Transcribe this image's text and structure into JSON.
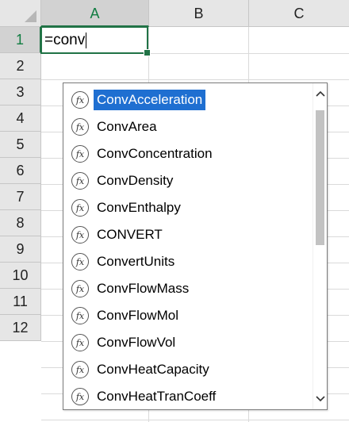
{
  "columns": [
    {
      "label": "A",
      "selected": true
    },
    {
      "label": "B",
      "selected": false
    },
    {
      "label": "C",
      "selected": false
    }
  ],
  "rows": [
    "1",
    "2",
    "3",
    "4",
    "5",
    "6",
    "7",
    "8",
    "9",
    "10",
    "11",
    "12"
  ],
  "active_cell": {
    "reference": "A1",
    "formula": "=conv"
  },
  "autocomplete": {
    "highlighted_index": 0,
    "items": [
      {
        "label": "ConvAcceleration",
        "icon": "function-icon"
      },
      {
        "label": "ConvArea",
        "icon": "function-icon"
      },
      {
        "label": "ConvConcentration",
        "icon": "function-icon"
      },
      {
        "label": "ConvDensity",
        "icon": "function-icon"
      },
      {
        "label": "ConvEnthalpy",
        "icon": "function-icon"
      },
      {
        "label": "CONVERT",
        "icon": "function-icon"
      },
      {
        "label": "ConvertUnits",
        "icon": "function-icon"
      },
      {
        "label": "ConvFlowMass",
        "icon": "function-icon"
      },
      {
        "label": "ConvFlowMol",
        "icon": "function-icon"
      },
      {
        "label": "ConvFlowVol",
        "icon": "function-icon"
      },
      {
        "label": "ConvHeatCapacity",
        "icon": "function-icon"
      },
      {
        "label": "ConvHeatTranCoeff",
        "icon": "function-icon"
      }
    ],
    "icon_glyph": "fx",
    "scroll_up_glyph": "⌃",
    "scroll_down_glyph": "⌄",
    "scroll_position_fraction": 0.0
  },
  "colors": {
    "accent": "#217346",
    "highlight": "#1f6fd1",
    "header_bg": "#e6e6e6"
  }
}
